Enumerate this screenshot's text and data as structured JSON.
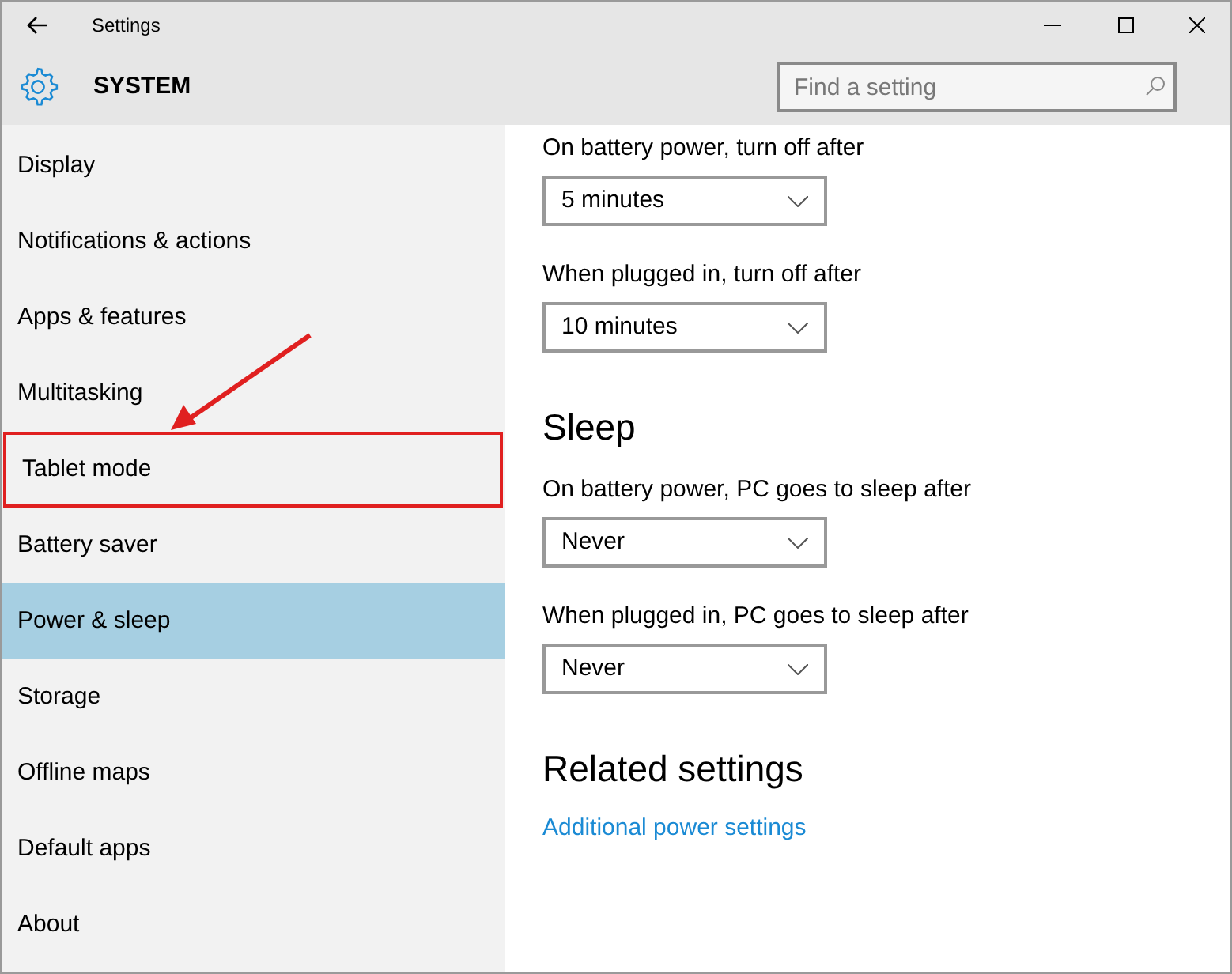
{
  "window": {
    "title": "Settings"
  },
  "header": {
    "title": "SYSTEM",
    "search": {
      "placeholder": "Find a setting"
    }
  },
  "sidebar": {
    "items": [
      {
        "label": "Display",
        "selected": false,
        "highlighted": false
      },
      {
        "label": "Notifications & actions",
        "selected": false,
        "highlighted": false
      },
      {
        "label": "Apps & features",
        "selected": false,
        "highlighted": false
      },
      {
        "label": "Multitasking",
        "selected": false,
        "highlighted": false
      },
      {
        "label": "Tablet mode",
        "selected": false,
        "highlighted": true
      },
      {
        "label": "Battery saver",
        "selected": false,
        "highlighted": false
      },
      {
        "label": "Power & sleep",
        "selected": true,
        "highlighted": false
      },
      {
        "label": "Storage",
        "selected": false,
        "highlighted": false
      },
      {
        "label": "Offline maps",
        "selected": false,
        "highlighted": false
      },
      {
        "label": "Default apps",
        "selected": false,
        "highlighted": false
      },
      {
        "label": "About",
        "selected": false,
        "highlighted": false
      }
    ]
  },
  "content": [
    {
      "kind": "dropdown",
      "label": "On battery power, turn off after",
      "value": "5 minutes"
    },
    {
      "kind": "dropdown",
      "label": "When plugged in, turn off after",
      "value": "10 minutes"
    },
    {
      "kind": "heading",
      "text": "Sleep"
    },
    {
      "kind": "dropdown",
      "label": "On battery power, PC goes to sleep after",
      "value": "Never"
    },
    {
      "kind": "dropdown",
      "label": "When plugged in, PC goes to sleep after",
      "value": "Never"
    },
    {
      "kind": "heading",
      "text": "Related settings"
    },
    {
      "kind": "link",
      "text": "Additional power settings"
    }
  ]
}
